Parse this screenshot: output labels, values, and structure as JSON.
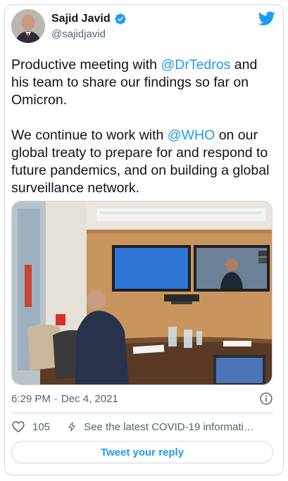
{
  "author": {
    "display_name": "Sajid Javid",
    "handle": "@sajidjavid",
    "verified": true
  },
  "tweet": {
    "segments": [
      {
        "text": "Productive meeting with ",
        "type": "text"
      },
      {
        "text": "@DrTedros",
        "type": "mention"
      },
      {
        "text": " and his team to share our findings so far on Omicron.\n\nWe continue to work with ",
        "type": "text"
      },
      {
        "text": "@WHO",
        "type": "mention"
      },
      {
        "text": " on our global treaty to prepare for and respond to future pandemics, and on building a global surveillance network.",
        "type": "text"
      }
    ]
  },
  "meta": {
    "time": "6:29 PM",
    "separator": "·",
    "date": "Dec 4, 2021"
  },
  "actions": {
    "like_count": "105",
    "covid_link_text": "See the latest COVID-19 information on Twitter"
  },
  "reply_button": {
    "label": "Tweet your reply"
  },
  "colors": {
    "accent": "#1d9bf0",
    "text": "#0f1419",
    "muted": "#536471",
    "border": "#cfd9de"
  },
  "icons": [
    "verified-badge-icon",
    "twitter-bird-icon",
    "info-icon",
    "heart-icon",
    "lightning-icon"
  ]
}
